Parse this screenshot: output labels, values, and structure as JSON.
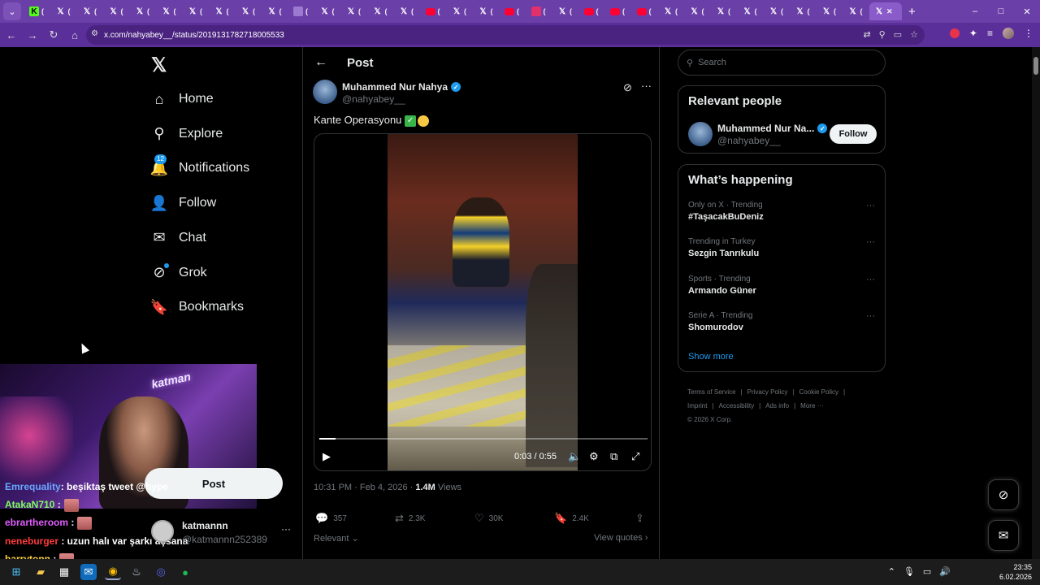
{
  "browser": {
    "tab_count_icons": [
      "k",
      "x",
      "x",
      "x",
      "x",
      "x",
      "x",
      "x",
      "x",
      "x",
      "other",
      "x",
      "x",
      "x",
      "x",
      "yt",
      "x",
      "x",
      "yt",
      "ig",
      "x",
      "yt",
      "yt",
      "yt",
      "x",
      "x",
      "x",
      "x",
      "x",
      "x",
      "x",
      "x"
    ],
    "new_tab_symbol": "+",
    "url": "x.com/nahyabey__/status/2019131782718005533",
    "window_controls": [
      "–",
      "□",
      "✕"
    ]
  },
  "sidebar": {
    "logo": "𝕏",
    "items": [
      {
        "label": "Home",
        "icon": "home-icon",
        "glyph": "⌂"
      },
      {
        "label": "Explore",
        "icon": "search-icon",
        "glyph": "⚲"
      },
      {
        "label": "Notifications",
        "icon": "bell-icon",
        "glyph": "🔔",
        "badge": "12"
      },
      {
        "label": "Follow",
        "icon": "person-add-icon",
        "glyph": "👤"
      },
      {
        "label": "Chat",
        "icon": "envelope-icon",
        "glyph": "✉"
      },
      {
        "label": "Grok",
        "icon": "grok-icon",
        "glyph": "⊘"
      },
      {
        "label": "Bookmarks",
        "icon": "bookmark-icon",
        "glyph": "🔖"
      }
    ],
    "post_button": "Post",
    "account": {
      "name": "katmannn",
      "handle": "@katmannn252389",
      "more": "···"
    }
  },
  "stream_overlay": {
    "webcam_sign": "katman",
    "chat": [
      {
        "user": "Emrequality",
        "msg": ": beşiktaş tweet @hype",
        "color": "#6aa7ff"
      },
      {
        "user": "AtakaN710",
        "msg": " :",
        "color": "#7cff5a",
        "emote": true
      },
      {
        "user": "ebrartheroom",
        "msg": " :",
        "color": "#e05cff",
        "emote": true
      },
      {
        "user": "neneburger",
        "msg": " : uzun halı var şarkı açsana",
        "color": "#ff3b3b"
      },
      {
        "user": "barrytonn",
        "msg": " :",
        "color": "#ffd23b",
        "emote": true
      }
    ]
  },
  "main": {
    "header_title": "Post",
    "back_glyph": "←",
    "author": {
      "name": "Muhammed Nur Nahya",
      "handle": "@nahyabey__"
    },
    "tweet_text": "Kante Operasyonu",
    "video": {
      "time": "0:03 / 0:55",
      "progress": 0.05
    },
    "meta": {
      "timestamp": "10:31 PM · Feb 4, 2026 · ",
      "views_count": "1.4M",
      "views_label": " Views"
    },
    "actions": {
      "replies": "357",
      "reposts": "2.3K",
      "likes": "30K",
      "bookmarks": "2.4K"
    },
    "sort_label": "Relevant",
    "view_quotes": "View quotes"
  },
  "right": {
    "search_placeholder": "Search",
    "relevant_people": {
      "title": "Relevant people",
      "name": "Muhammed Nur Na...",
      "handle": "@nahyabey__",
      "follow_label": "Follow"
    },
    "happening": {
      "title": "What’s happening",
      "trends": [
        {
          "context": "Only on X · Trending",
          "name": "#TaşacakBuDeniz"
        },
        {
          "context": "Trending in Turkey",
          "name": "Sezgin Tanrıkulu"
        },
        {
          "context": "Sports · Trending",
          "name": "Armando Güner"
        },
        {
          "context": "Serie A · Trending",
          "name": "Shomurodov"
        }
      ],
      "show_more": "Show more"
    },
    "footer": {
      "links1": [
        "Terms of Service",
        "|",
        "Privacy Policy",
        "|",
        "Cookie Policy",
        "|"
      ],
      "links2": [
        "Imprint",
        "|",
        "Accessibility",
        "|",
        "Ads info",
        "|",
        "More ···"
      ],
      "copyright": "© 2026 X Corp."
    }
  },
  "taskbar": {
    "time": "23:35",
    "date": "6.02.2026"
  }
}
